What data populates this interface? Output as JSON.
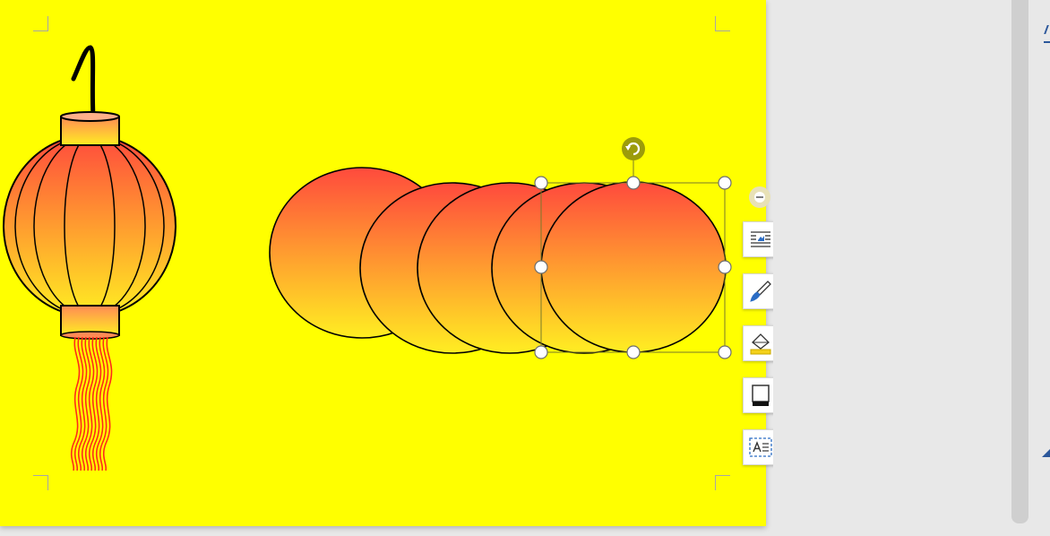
{
  "document": {
    "page_color": "#ffff00",
    "lantern_gradient": {
      "top": "#ff4a3d",
      "bottom": "#ffee22"
    },
    "tassel_color": "#ff2a1a",
    "outline_color": "#000000"
  },
  "selection": {
    "handle_color": "#ffffff",
    "rotate_handle_color": "#9c9c0a"
  },
  "float_toolbar": {
    "items": [
      {
        "name": "collapse",
        "icon": "minus-circle-icon"
      },
      {
        "name": "layout-options",
        "icon": "text-wrap-icon"
      },
      {
        "name": "shape-style",
        "icon": "paintbrush-icon"
      },
      {
        "name": "shape-fill",
        "icon": "fill-bucket-icon"
      },
      {
        "name": "shape-outline",
        "icon": "outline-square-icon"
      },
      {
        "name": "text-box",
        "icon": "text-box-icon"
      }
    ]
  }
}
